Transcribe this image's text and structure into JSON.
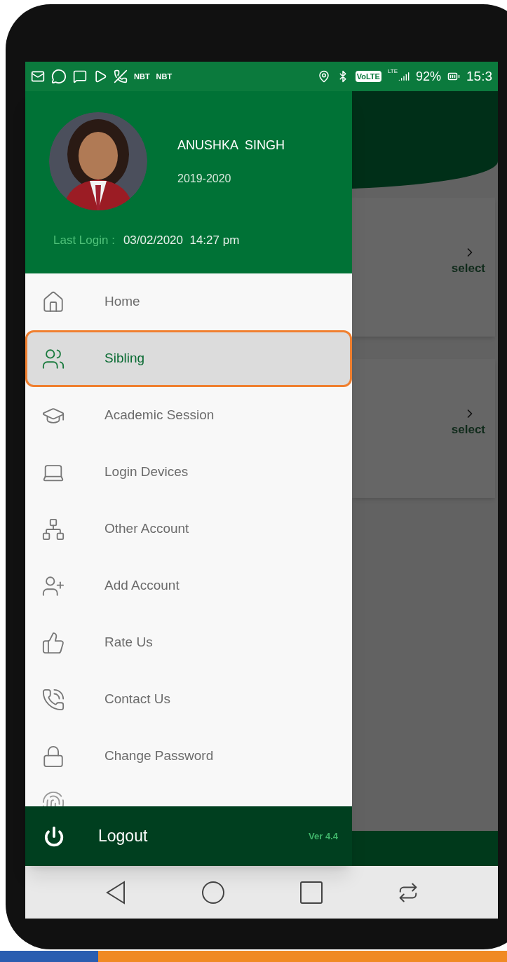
{
  "status_bar": {
    "notification_labels": [
      "NBT",
      "NBT"
    ],
    "network": "VoLTE",
    "network_type": "LTE",
    "battery": "92%",
    "time": "15:3"
  },
  "profile": {
    "name": "ANUSHKA  SINGH",
    "session": "2019-2020",
    "last_login_label": "Last Login :",
    "last_login_value": "03/02/2020  14:27 pm"
  },
  "menu": [
    {
      "label": "Home",
      "selected": false
    },
    {
      "label": "Sibling",
      "selected": true
    },
    {
      "label": "Academic Session",
      "selected": false
    },
    {
      "label": "Login Devices",
      "selected": false
    },
    {
      "label": "Other Account",
      "selected": false
    },
    {
      "label": "Add Account",
      "selected": false
    },
    {
      "label": "Rate Us",
      "selected": false
    },
    {
      "label": "Contact Us",
      "selected": false
    },
    {
      "label": "Change Password",
      "selected": false
    }
  ],
  "footer": {
    "logout": "Logout",
    "version": "Ver 4.4"
  },
  "background_cards": [
    {
      "action": "select"
    },
    {
      "action": "select"
    }
  ]
}
